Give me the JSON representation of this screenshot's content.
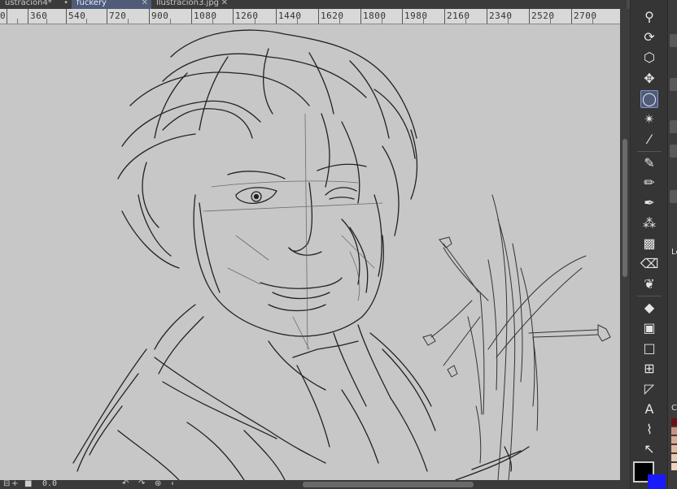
{
  "tabs": [
    {
      "label": "ustracion4*",
      "marker": "•"
    },
    {
      "label": "fuckery",
      "marker": "✕"
    },
    {
      "label": "llustracion3.jpg",
      "marker": "✕"
    }
  ],
  "ruler": {
    "labels": [
      "0",
      "360",
      "540",
      "720",
      "900",
      "1080",
      "1260",
      "1440",
      "1620",
      "1800",
      "1980",
      "2160",
      "2340",
      "2520",
      "2700"
    ]
  },
  "statusbar": {
    "zoom_text": "0.0"
  },
  "right_panel": {
    "layer_label": "Le",
    "side_label": "C"
  },
  "colors": {
    "foreground": "#000000",
    "background": "#1a1aff",
    "accent": "#4f5b78"
  }
}
